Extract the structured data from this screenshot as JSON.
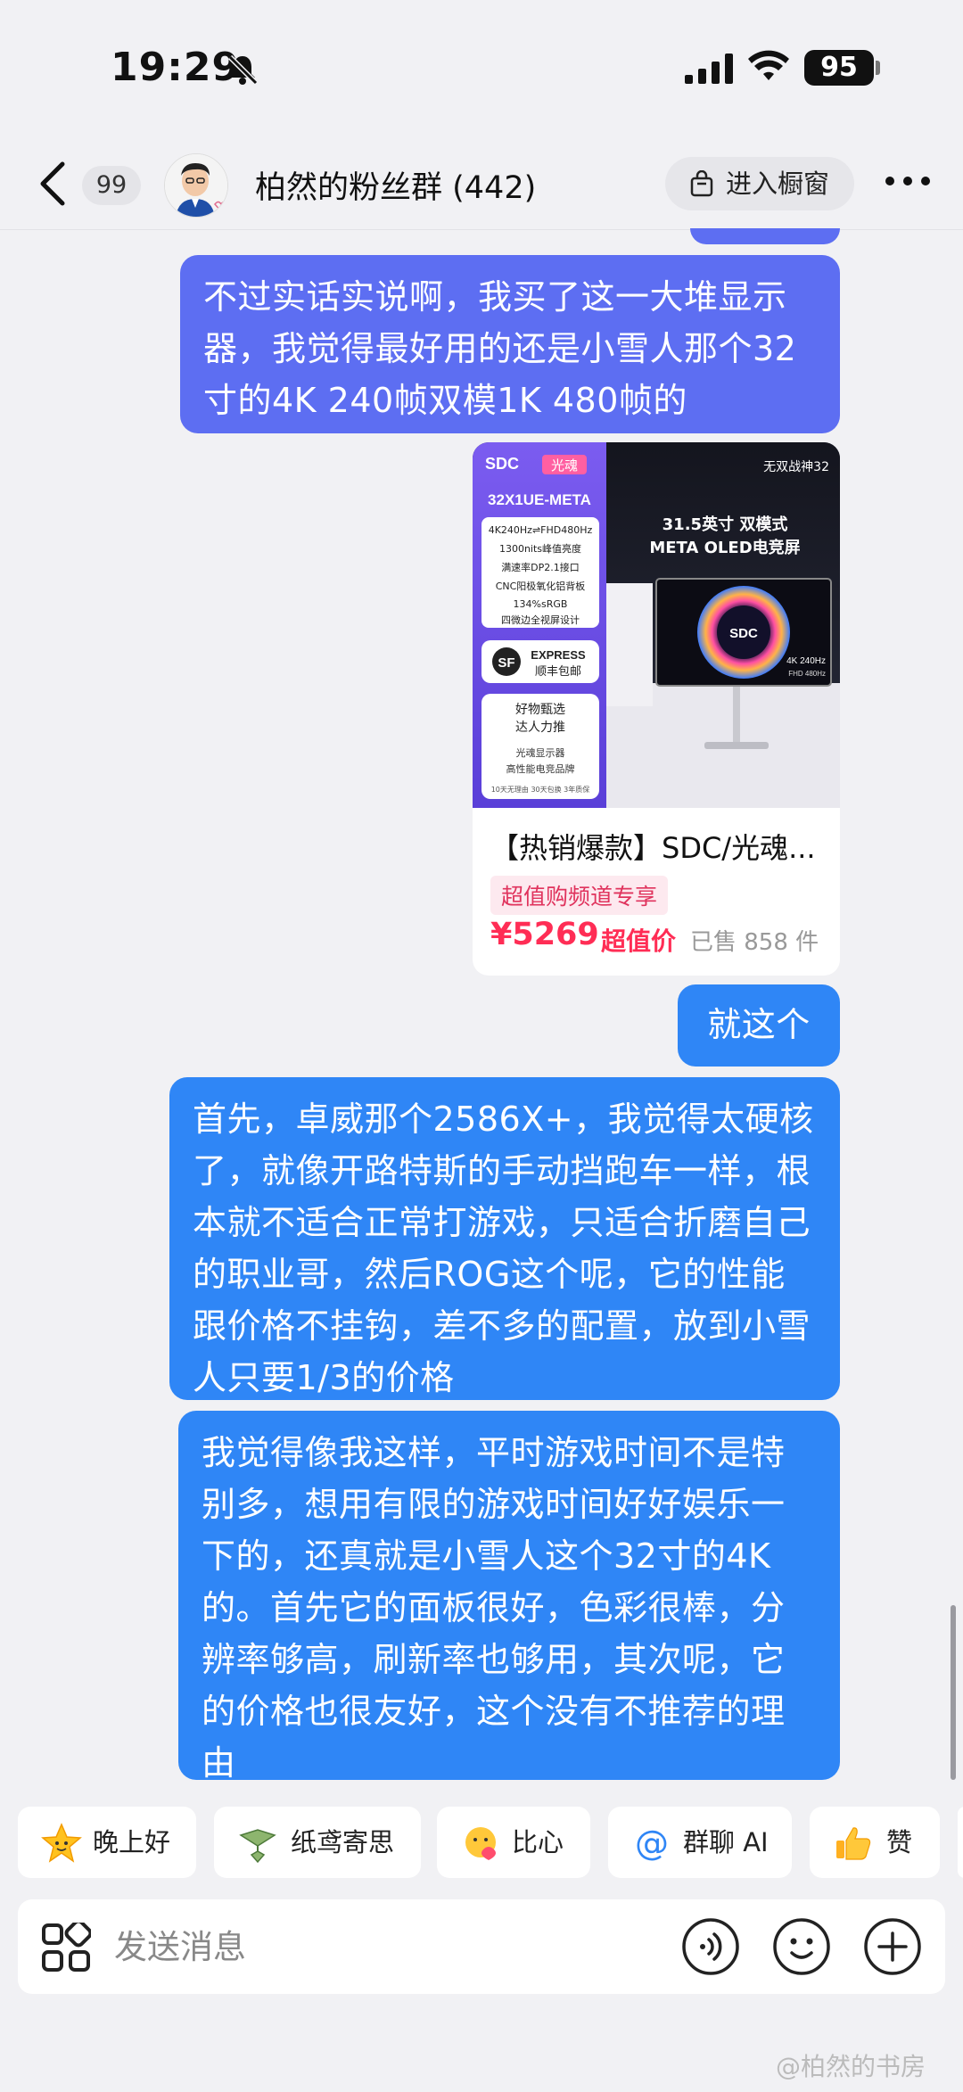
{
  "status_bar": {
    "time": "19:29",
    "battery": "95"
  },
  "header": {
    "unread_count": "99",
    "group_name": "柏然的粉丝群 (442)",
    "store_button": "进入橱窗"
  },
  "messages": [
    {
      "text": "不过实话实说啊，我买了这一大堆显示器，我觉得最好用的还是小雪人那个32寸的4K 240帧双模1K 480帧的"
    },
    {
      "text": "就这个"
    },
    {
      "text": "首先，卓威那个2586X+，我觉得太硬核了，就像开路特斯的手动挡跑车一样，根本就不适合正常打游戏，只适合折磨自己的职业哥，然后ROG这个呢，它的性能跟价格不挂钩，差不多的配置，放到小雪人只要1/3的价格"
    },
    {
      "text": "我觉得像我这样，平时游戏时间不是特别多，想用有限的游戏时间好好娱乐一下的，还真就是小雪人这个32寸的4K的。首先它的面板很好，色彩很棒，分辨率够高，刷新率也够用，其次呢，它的价格也很友好，这个没有不推荐的理由"
    }
  ],
  "product": {
    "image": {
      "brand": "SDC",
      "brand_cn": "光魂",
      "model": "32X1UE-META",
      "top_right": "无双战神32",
      "headline_1": "31.5英寸 双模式",
      "headline_2": "META OLED电竞屏",
      "specs": [
        "4K240Hz⇌FHD480Hz",
        "1300nits峰值亮度",
        "满速率DP2.1接口",
        "CNC阳极氧化铝背板",
        "134%sRGB",
        "四微边全视屏设计"
      ],
      "express_en": "EXPRESS",
      "express_cn": "顺丰包邮",
      "badge_1": "好物甄选",
      "badge_2": "达人力推",
      "badge_3": "光魂显示器",
      "badge_4": "高性能电竞品牌",
      "fine_print": "10天无理由 30天包换 3年质保",
      "screen_logo": "SDC",
      "screen_spec_1": "4K 240Hz",
      "screen_spec_2": "FHD 480Hz"
    },
    "title": "【热销爆款】SDC/光魂...",
    "tag": "超值购频道专享",
    "price": "¥5269",
    "price_tag": "超值价",
    "sold": "已售 858 件"
  },
  "quick_replies": [
    "晚上好",
    "纸鸢寄思",
    "比心",
    "群聊 AI",
    "赞"
  ],
  "input": {
    "placeholder": "发送消息"
  },
  "watermark": "@柏然的书房",
  "colors": {
    "bubble_purple": "#5d6ef2",
    "bubble_blue": "#2f86f6",
    "price": "#ff2d55"
  }
}
